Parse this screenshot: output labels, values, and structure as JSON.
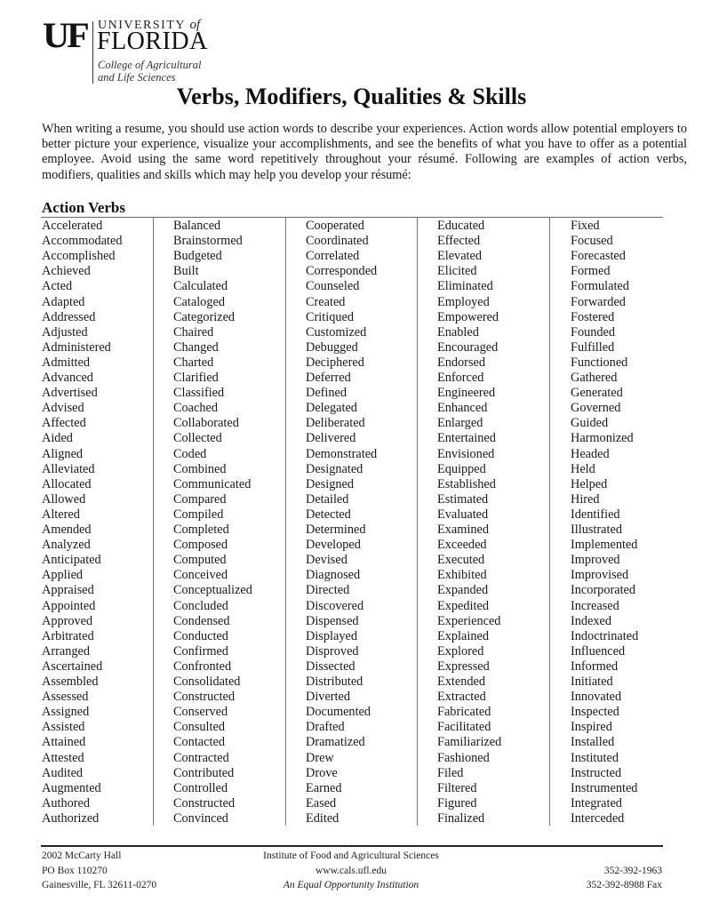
{
  "logo": {
    "mark": "UF",
    "university_line": "UNIVERSITY",
    "of": "of",
    "florida": "FLORIDA",
    "college_line1": "College of Agricultural",
    "college_line2": "and Life Sciences"
  },
  "title": "Verbs, Modifiers, Qualities & Skills",
  "intro": "When writing a resume, you should use action words to describe your experiences. Action words allow potential employers to better picture your experience, visualize your accomplishments, and see the benefits of what you have to offer as a potential employee. Avoid using the same word repetitively throughout your résumé. Following are examples of action verbs, modifiers, qualities and skills which may help you develop your résumé:",
  "section": {
    "heading": "Action Verbs",
    "columns": [
      [
        "Accelerated",
        "Accommodated",
        "Accomplished",
        "Achieved",
        "Acted",
        "Adapted",
        "Addressed",
        "Adjusted",
        "Administered",
        "Admitted",
        "Advanced",
        "Advertised",
        "Advised",
        "Affected",
        "Aided",
        "Aligned",
        "Alleviated",
        "Allocated",
        "Allowed",
        "Altered",
        "Amended",
        "Analyzed",
        "Anticipated",
        "Applied",
        "Appraised",
        "Appointed",
        "Approved",
        "Arbitrated",
        "Arranged",
        "Ascertained",
        "Assembled",
        "Assessed",
        "Assigned",
        "Assisted",
        "Attained",
        "Attested",
        "Audited",
        "Augmented",
        "Authored",
        "Authorized"
      ],
      [
        "Balanced",
        "Brainstormed",
        "Budgeted",
        "Built",
        "Calculated",
        "Cataloged",
        "Categorized",
        "Chaired",
        "Changed",
        "Charted",
        "Clarified",
        "Classified",
        "Coached",
        "Collaborated",
        "Collected",
        "Coded",
        "Combined",
        "Communicated",
        "Compared",
        "Compiled",
        "Completed",
        "Composed",
        "Computed",
        "Conceived",
        "Conceptualized",
        "Concluded",
        "Condensed",
        "Conducted",
        "Confirmed",
        "Confronted",
        "Consolidated",
        "Constructed",
        "Conserved",
        "Consulted",
        "Contacted",
        "Contracted",
        "Contributed",
        "Controlled",
        "Constructed",
        "Convinced"
      ],
      [
        "Cooperated",
        "Coordinated",
        "Correlated",
        "Corresponded",
        "Counseled",
        "Created",
        "Critiqued",
        "Customized",
        "Debugged",
        "Deciphered",
        "Deferred",
        "Defined",
        "Delegated",
        "Deliberated",
        "Delivered",
        "Demonstrated",
        "Designated",
        "Designed",
        "Detailed",
        "Detected",
        "Determined",
        "Developed",
        "Devised",
        "Diagnosed",
        "Directed",
        "Discovered",
        "Dispensed",
        "Displayed",
        "Disproved",
        "Dissected",
        "Distributed",
        "Diverted",
        "Documented",
        "Drafted",
        "Dramatized",
        "Drew",
        "Drove",
        "Earned",
        "Eased",
        "Edited"
      ],
      [
        "Educated",
        "Effected",
        "Elevated",
        "Elicited",
        "Eliminated",
        "Employed",
        "Empowered",
        "Enabled",
        "Encouraged",
        "Endorsed",
        "Enforced",
        "Engineered",
        "Enhanced",
        "Enlarged",
        "Entertained",
        "Envisioned",
        "Equipped",
        "Established",
        "Estimated",
        "Evaluated",
        "Examined",
        "Exceeded",
        "Executed",
        "Exhibited",
        "Expanded",
        "Expedited",
        "Experienced",
        "Explained",
        "Explored",
        "Expressed",
        "Extended",
        "Extracted",
        "Fabricated",
        "Facilitated",
        "Familiarized",
        "Fashioned",
        "Filed",
        "Filtered",
        "Figured",
        "Finalized"
      ],
      [
        "Fixed",
        "Focused",
        "Forecasted",
        "Formed",
        "Formulated",
        "Forwarded",
        "Fostered",
        "Founded",
        "Fulfilled",
        "Functioned",
        "Gathered",
        "Generated",
        "Governed",
        "Guided",
        "Harmonized",
        "Headed",
        "Held",
        "Helped",
        "Hired",
        "Identified",
        "Illustrated",
        "Implemented",
        "Improved",
        "Improvised",
        "Incorporated",
        "Increased",
        "Indexed",
        "Indoctrinated",
        "Influenced",
        "Informed",
        "Initiated",
        "Innovated",
        "Inspected",
        "Inspired",
        "Installed",
        "Instituted",
        "Instructed",
        "Instrumented",
        "Integrated",
        "Interceded"
      ]
    ]
  },
  "footer": {
    "left": [
      "2002 McCarty Hall",
      "PO Box 110270",
      "Gainesville, FL  32611-0270"
    ],
    "center": [
      "Institute of Food and Agricultural Sciences",
      "www.cals.ufl.edu",
      "An Equal Opportunity Institution"
    ],
    "right": [
      "",
      "352-392-1963",
      "352-392-8988 Fax"
    ]
  }
}
